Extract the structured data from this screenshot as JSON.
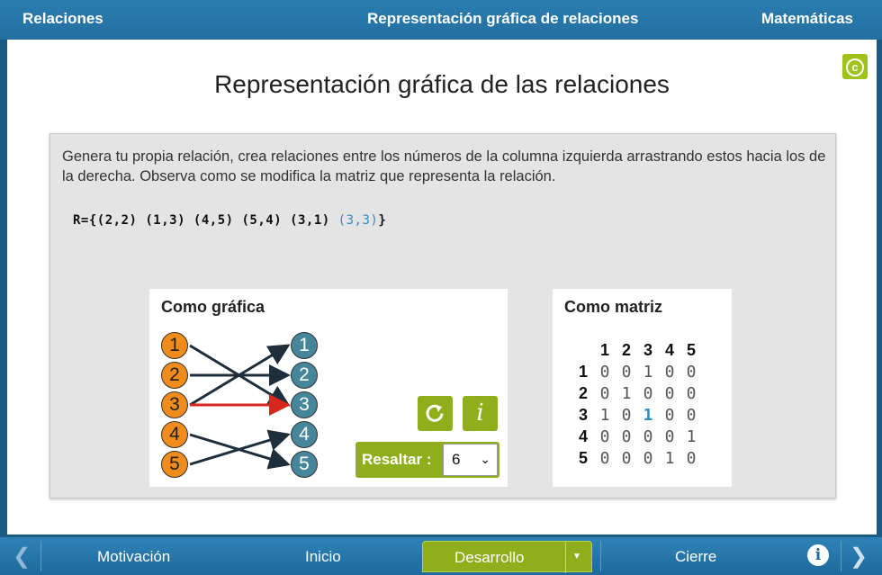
{
  "header": {
    "left": "Relaciones",
    "center": "Representación gráfica de relaciones",
    "right": "Matemáticas"
  },
  "page_title": "Representación gráfica de las relaciones",
  "instructions": "Genera tu propia relación, crea relaciones entre los números de la columna izquierda arrastrando estos hacia los de la derecha. Observa como se modifica la matriz que representa la relación.",
  "relation": {
    "prefix": "R={(2,2) (1,3) (4,5) (5,4) (3,1) ",
    "highlighted": "(3,3)",
    "suffix": "}"
  },
  "graph": {
    "title": "Como gráfica",
    "left_nodes": [
      "1",
      "2",
      "3",
      "4",
      "5"
    ],
    "right_nodes": [
      "1",
      "2",
      "3",
      "4",
      "5"
    ],
    "edges": [
      [
        2,
        2
      ],
      [
        1,
        3
      ],
      [
        4,
        5
      ],
      [
        5,
        4
      ],
      [
        3,
        1
      ],
      [
        3,
        3
      ]
    ],
    "highlight_edge": [
      3,
      3
    ],
    "colors": {
      "left_node": "#f08c1c",
      "right_node": "#46869a",
      "edge": "#1e2e3a",
      "highlight": "#d9261c"
    }
  },
  "controls": {
    "resaltar_label": "Resaltar :",
    "resaltar_value": "6"
  },
  "matrix": {
    "title": "Como matriz",
    "col_headers": [
      "1",
      "2",
      "3",
      "4",
      "5"
    ],
    "row_headers": [
      "1",
      "2",
      "3",
      "4",
      "5"
    ],
    "rows": [
      [
        "0",
        "0",
        "1",
        "0",
        "0"
      ],
      [
        "0",
        "1",
        "0",
        "0",
        "0"
      ],
      [
        "1",
        "0",
        "1",
        "0",
        "0"
      ],
      [
        "0",
        "0",
        "0",
        "0",
        "1"
      ],
      [
        "0",
        "0",
        "0",
        "1",
        "0"
      ]
    ],
    "highlight_cell": [
      3,
      3
    ]
  },
  "footer": {
    "motivacion": "Motivación",
    "inicio": "Inicio",
    "desarrollo": "Desarrollo",
    "cierre": "Cierre"
  },
  "accent": "#8fae1b",
  "brand": "#2678aa"
}
